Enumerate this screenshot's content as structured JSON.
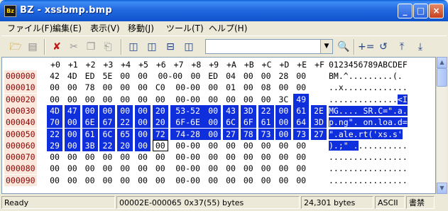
{
  "window": {
    "icon_text": "Bz",
    "title": "BZ - xssbmp.bmp",
    "controls": {
      "minimize": "_",
      "maximize": "□",
      "close": "×"
    }
  },
  "menu": [
    "ファイル(F)",
    "編集(E)",
    "表示(V)",
    "移動(J)",
    "ツール(T)",
    "ヘルプ(H)"
  ],
  "toolbar": {
    "search_value": "",
    "icons": [
      "open-folder-icon",
      "save-icon",
      "delete-icon",
      "cut-icon",
      "copy-icon",
      "paste-icon",
      "view-single-icon",
      "view-split-vertical-icon",
      "view-split-horizontal-icon",
      "view-tile-icon",
      "find-binoculars-icon",
      "compare-icon",
      "undo-jump-icon",
      "go-top-icon",
      "go-bottom-icon"
    ]
  },
  "hex": {
    "header": [
      "+0",
      "+1",
      "+2",
      "+3",
      "+4",
      "+5",
      "+6",
      "+7",
      "+8",
      "+9",
      "+A",
      "+B",
      "+C",
      "+D",
      "+E",
      "+F"
    ],
    "ascii_header": "0123456789ABCDEF",
    "rows": [
      {
        "addr": "000000",
        "bytes": [
          "42",
          "4D",
          "ED",
          "5E",
          "00",
          "00",
          "00-00",
          "",
          "00",
          "ED",
          "04",
          "00",
          "00",
          "28",
          "00"
        ],
        "ascii": "BM.^.........(."
      },
      {
        "addr": "000010",
        "bytes": [
          "00",
          "00",
          "78",
          "00",
          "00",
          "00",
          "C0",
          "00-00",
          "",
          "00",
          "01",
          "00",
          "08",
          "00",
          "00"
        ],
        "ascii": "..x............."
      },
      {
        "addr": "000020",
        "bytes": [
          "00",
          "00",
          "00",
          "00",
          "00",
          "00",
          "00",
          "00-00",
          "",
          "00",
          "00",
          "00",
          "00",
          "3C",
          "49"
        ],
        "ascii": "..............<I"
      },
      {
        "addr": "000030",
        "bytes": [
          "4D",
          "47",
          "00",
          "00",
          "00",
          "00",
          "20",
          "53-52",
          "",
          "00",
          "43",
          "3D",
          "22",
          "00",
          "61",
          "2E"
        ],
        "ascii": "MG.... SR.C=\".a."
      },
      {
        "addr": "000040",
        "bytes": [
          "70",
          "00",
          "6E",
          "67",
          "22",
          "00",
          "20",
          "6F-6E",
          "",
          "00",
          "6C",
          "6F",
          "61",
          "00",
          "64",
          "3D"
        ],
        "ascii": "p.ng\". on.loa.d="
      },
      {
        "addr": "000050",
        "bytes": [
          "22",
          "00",
          "61",
          "6C",
          "65",
          "00",
          "72",
          "74-28",
          "",
          "00",
          "27",
          "78",
          "73",
          "00",
          "73",
          "27"
        ],
        "ascii": "\".ale.rt('xs.s'"
      },
      {
        "addr": "000060",
        "bytes": [
          "29",
          "00",
          "3B",
          "22",
          "20",
          "00",
          "00",
          "00-00",
          "",
          "00",
          "00",
          "00",
          "00",
          "00",
          "00"
        ],
        "ascii": ").;\" ..........."
      },
      {
        "addr": "000070",
        "bytes": [
          "00",
          "00",
          "00",
          "00",
          "00",
          "00",
          "00",
          "00-00",
          "",
          "00",
          "00",
          "00",
          "00",
          "00",
          "00"
        ],
        "ascii": "................"
      },
      {
        "addr": "000080",
        "bytes": [
          "00",
          "00",
          "00",
          "00",
          "00",
          "00",
          "00",
          "00-00",
          "",
          "00",
          "00",
          "00",
          "00",
          "00",
          "00"
        ],
        "ascii": "................"
      },
      {
        "addr": "000090",
        "bytes": [
          "00",
          "00",
          "00",
          "00",
          "00",
          "00",
          "00",
          "00-00",
          "",
          "00",
          "00",
          "00",
          "00",
          "00",
          "00"
        ],
        "ascii": "................"
      }
    ]
  },
  "status": {
    "ready": "Ready",
    "selection": "00002E-000065 0x37(55) bytes",
    "size": "24,301 bytes",
    "encoding": "ASCII",
    "mode": "書禁"
  }
}
